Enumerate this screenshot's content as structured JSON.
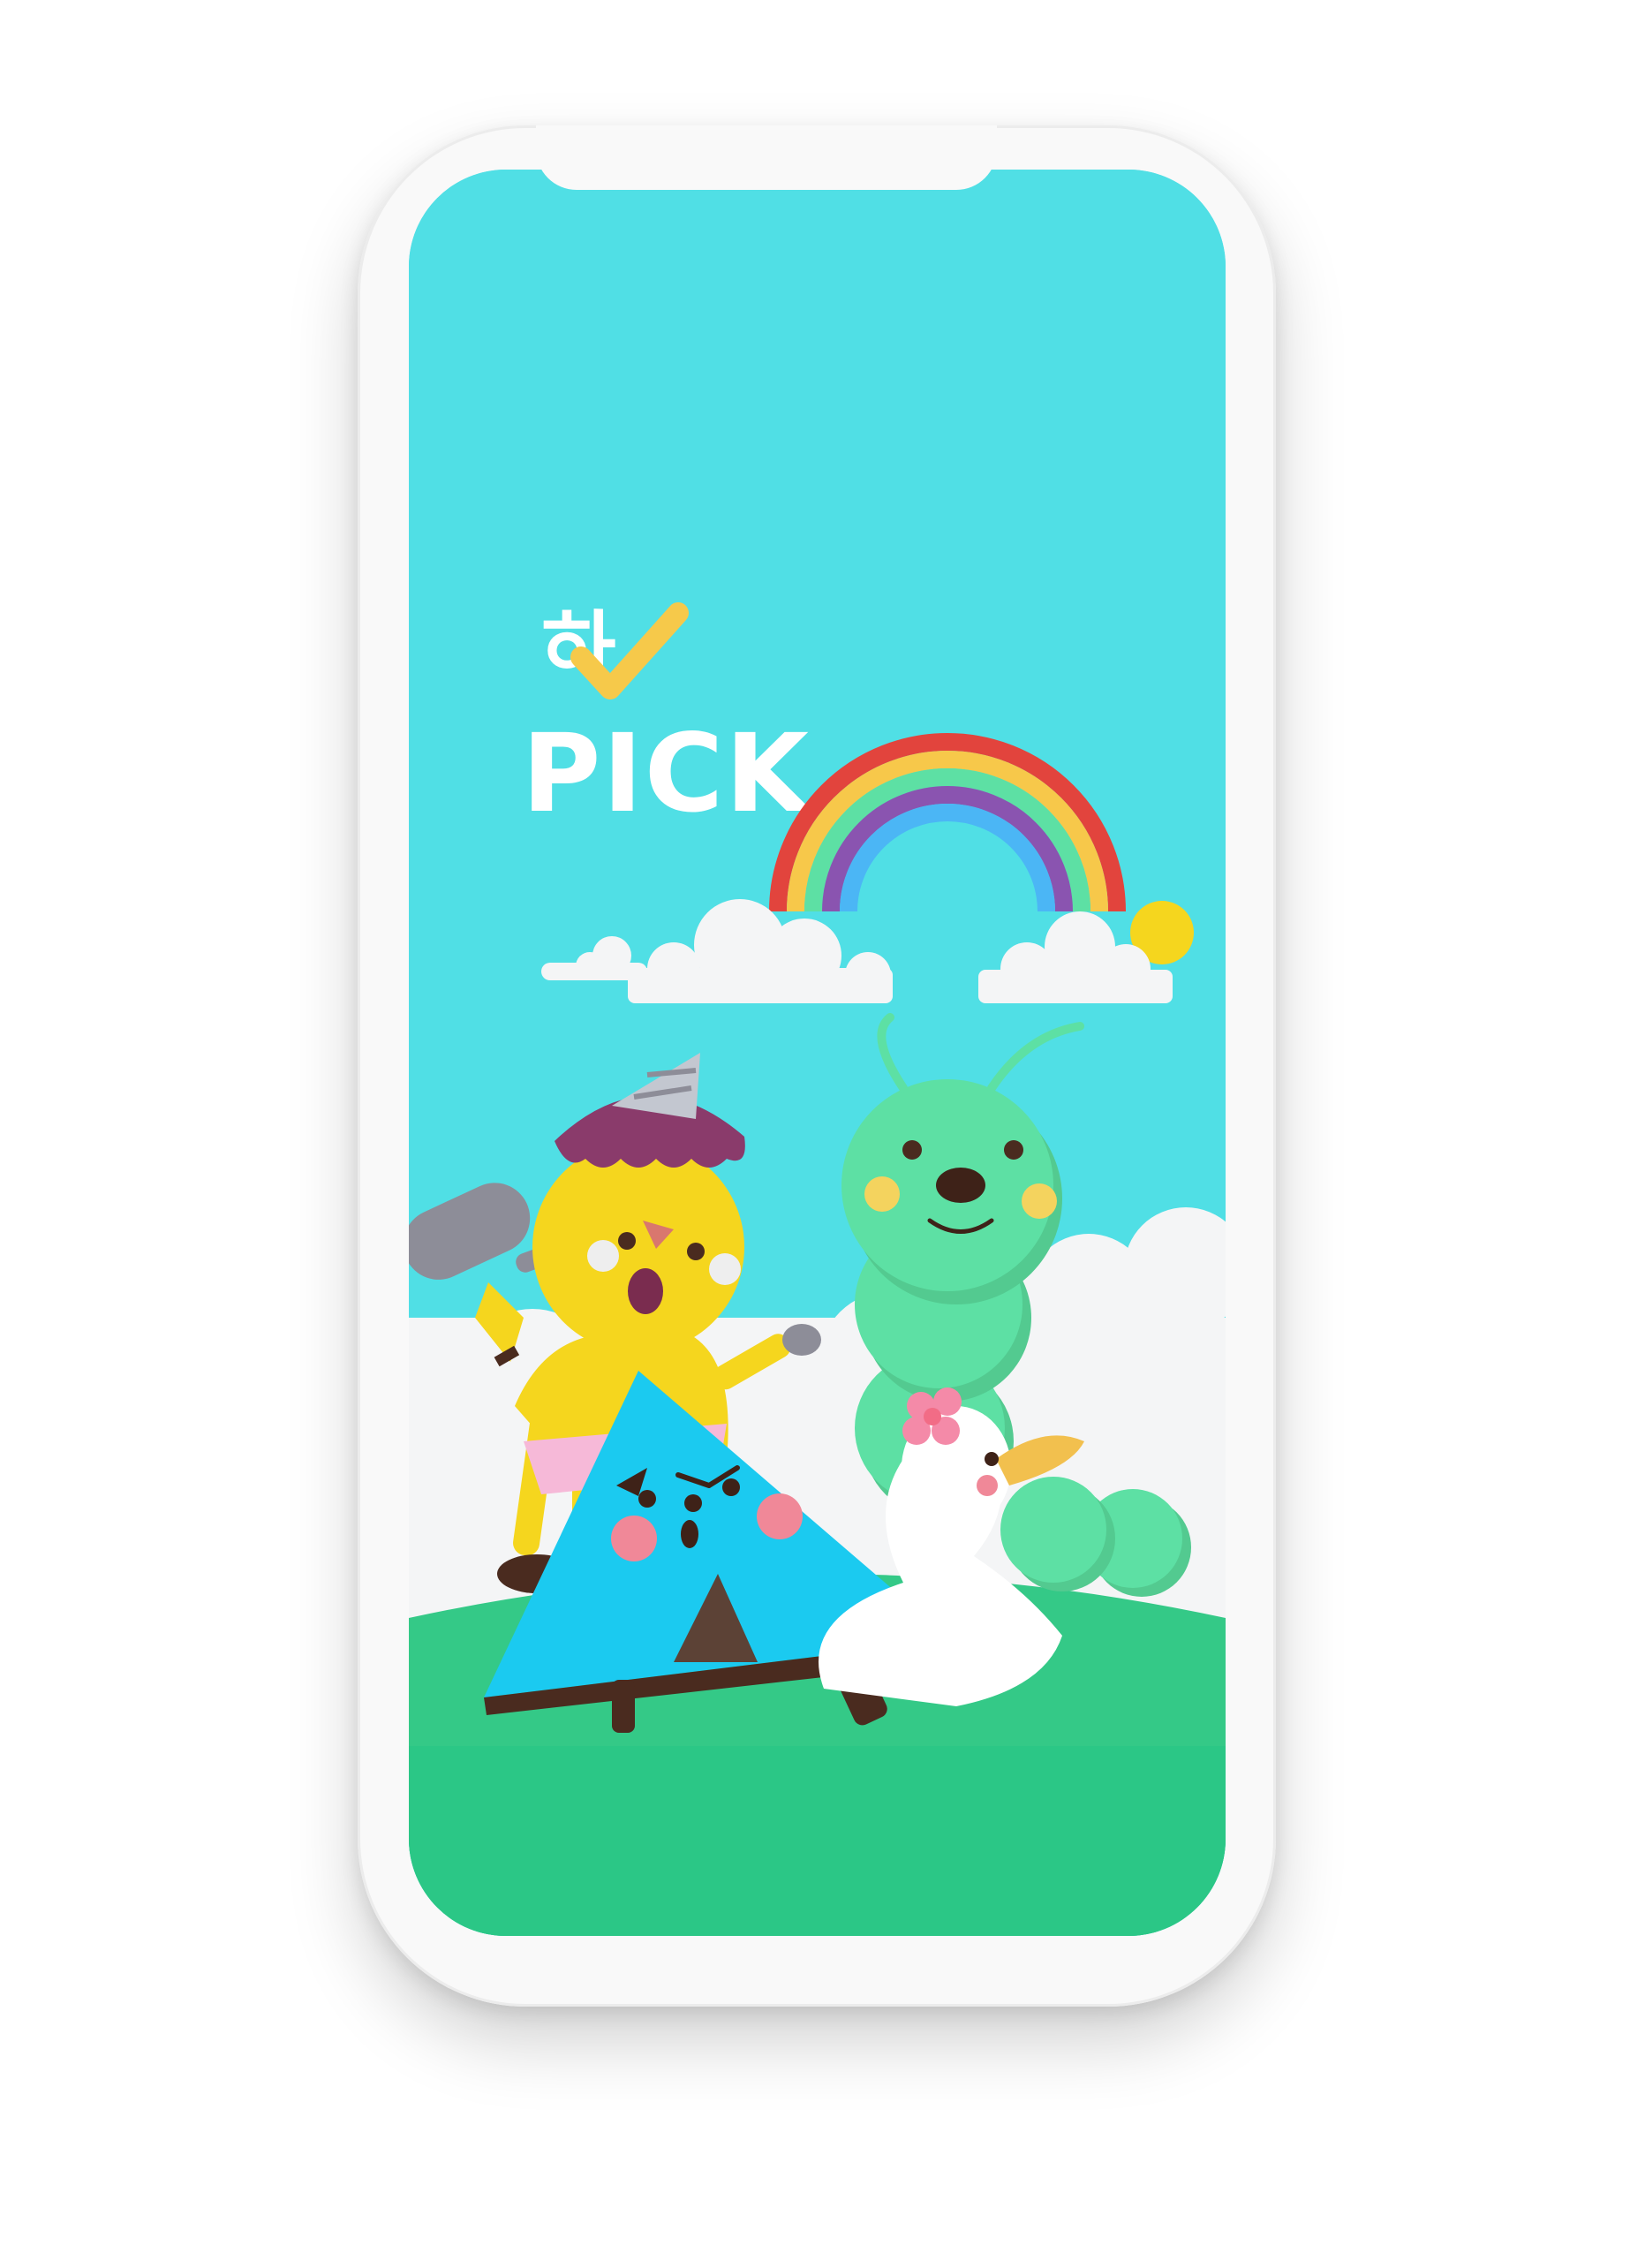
{
  "app": {
    "logo_hangul": "하",
    "logo_word": "PICK"
  },
  "icons": {
    "logo_check": "check-icon",
    "rainbow": "rainbow-icon",
    "sun": "sun-icon"
  },
  "colors": {
    "sky": "#50dfe5",
    "grass": "#2bc786",
    "rainbow": [
      "#e2443d",
      "#f7c84a",
      "#5de0a4",
      "#8a54b0",
      "#4bb6f5"
    ],
    "logo_check": "#f6c94a"
  }
}
